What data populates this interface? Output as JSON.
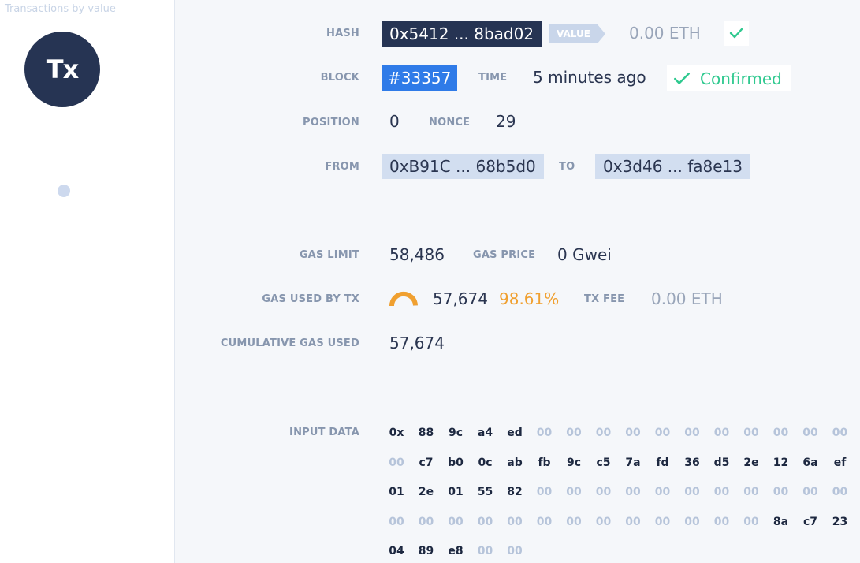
{
  "sidebar": {
    "title": "Transactions by value",
    "avatar_label": "Tx"
  },
  "tx": {
    "hash_label": "HASH",
    "hash": "0x5412 ... 8bad02",
    "value_label": "VALUE",
    "value": "0.00 ETH",
    "block_label": "BLOCK",
    "block": "#33357",
    "time_label": "TIME",
    "time": "5 minutes ago",
    "status": "Confirmed",
    "position_label": "POSITION",
    "position": "0",
    "nonce_label": "NONCE",
    "nonce": "29",
    "from_label": "FROM",
    "from": "0xB91C ... 68b5d0",
    "to_label": "TO",
    "to": "0x3d46 ... fa8e13"
  },
  "gas": {
    "limit_label": "GAS LIMIT",
    "limit": "58,486",
    "price_label": "GAS PRICE",
    "price": "0 Gwei",
    "used_label": "GAS USED BY TX",
    "used": "57,674",
    "used_pct": "98.61%",
    "used_fraction": 0.9861,
    "fee_label": "TX FEE",
    "fee": "0.00 ETH",
    "cumulative_label": "CUMULATIVE GAS USED",
    "cumulative": "57,674"
  },
  "input": {
    "label": "INPUT DATA",
    "bytes": [
      "0x",
      "88",
      "9c",
      "a4",
      "ed",
      "00",
      "00",
      "00",
      "00",
      "00",
      "00",
      "00",
      "00",
      "00",
      "00",
      "00",
      "00",
      "c7",
      "b0",
      "0c",
      "ab",
      "fb",
      "9c",
      "c5",
      "7a",
      "fd",
      "36",
      "d5",
      "2e",
      "12",
      "6a",
      "ef",
      "01",
      "2e",
      "01",
      "55",
      "82",
      "00",
      "00",
      "00",
      "00",
      "00",
      "00",
      "00",
      "00",
      "00",
      "00",
      "00",
      "00",
      "00",
      "00",
      "00",
      "00",
      "00",
      "00",
      "00",
      "00",
      "00",
      "00",
      "00",
      "00",
      "8a",
      "c7",
      "23",
      "04",
      "89",
      "e8",
      "00",
      "00"
    ]
  },
  "colors": {
    "dark_navy": "#263453",
    "accent_blue": "#2f7be8",
    "confirmed_green": "#2fc98f",
    "gauge_orange": "#f0a030",
    "light_chip": "#d2def0"
  }
}
